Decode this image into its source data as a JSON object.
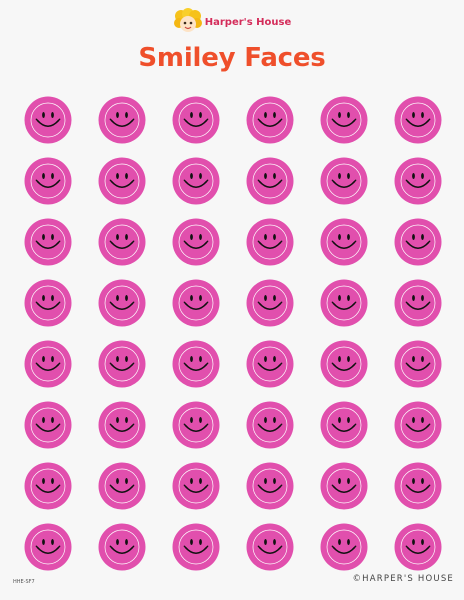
{
  "header": {
    "brand_name": "Harper's House",
    "logo_icon": "girl-face-logo-icon",
    "title": "Smiley Faces"
  },
  "sheet": {
    "rows": 8,
    "columns": 6,
    "sticker_icon": "smiley-face-icon",
    "sticker_fill": "#e14fad",
    "sticker_outline": "#ffffff",
    "feature_color": "#111111",
    "title_color": "#ef4f2b",
    "brand_color": "#d42c5a"
  },
  "footer": {
    "code": "HHE-SF7",
    "copyright": "©HARPER'S HOUSE"
  }
}
